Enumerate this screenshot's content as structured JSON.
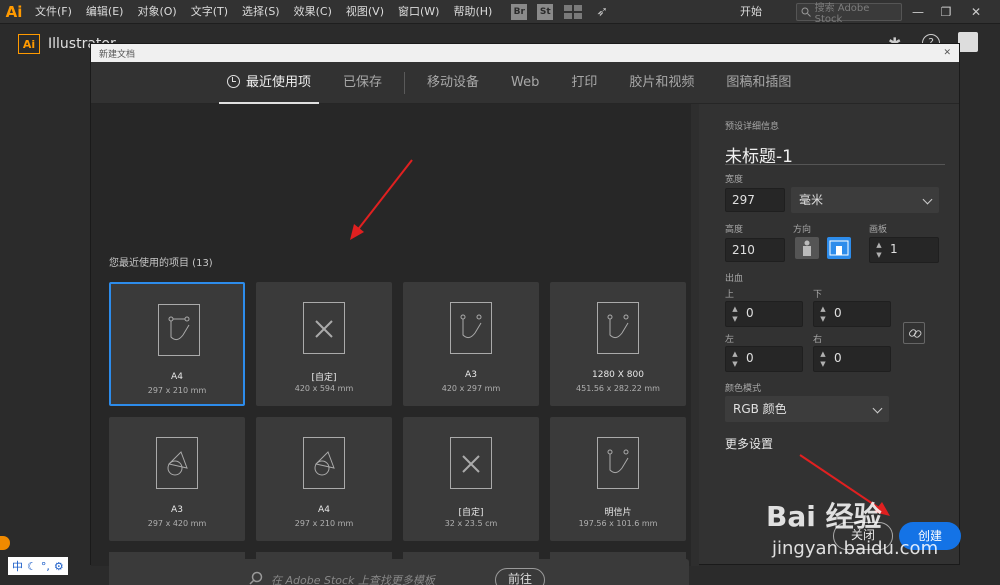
{
  "menubar": {
    "logo": "Ai",
    "items": [
      "文件(F)",
      "编辑(E)",
      "对象(O)",
      "文字(T)",
      "选择(S)",
      "效果(C)",
      "视图(V)",
      "窗口(W)",
      "帮助(H)"
    ],
    "bridge": "Br",
    "stock": "St",
    "workspace": "开始",
    "search_placeholder": "搜索 Adobe Stock"
  },
  "appbar": {
    "logo": "Ai",
    "title": "Illustrator"
  },
  "dialog": {
    "title": "新建文档",
    "tabs": [
      "最近使用项",
      "已保存",
      "移动设备",
      "Web",
      "打印",
      "胶片和视频",
      "图稿和插图"
    ],
    "recent_label": "您最近使用的项目 (13)",
    "presets": [
      {
        "name": "A4",
        "size": "297 x 210 mm",
        "icon": "artboard-icon",
        "selected": true
      },
      {
        "name": "[自定]",
        "size": "420 x 594 mm",
        "icon": "custom-doc-icon"
      },
      {
        "name": "A3",
        "size": "420 x 297 mm",
        "icon": "artboard-icon"
      },
      {
        "name": "1280 X 800",
        "size": "451.56 x 282.22 mm",
        "icon": "artboard-icon"
      },
      {
        "name": "A3",
        "size": "297 x 420 mm",
        "icon": "shapes-icon"
      },
      {
        "name": "A4",
        "size": "297 x 210 mm",
        "icon": "shapes-icon"
      },
      {
        "name": "[自定]",
        "size": "32 x 23.5 cm",
        "icon": "custom-doc-icon"
      },
      {
        "name": "明信片",
        "size": "197.56 x 101.6 mm",
        "icon": "artboard-icon"
      }
    ],
    "stock_search_placeholder": "在 Adobe Stock 上查找更多模板",
    "go_button": "前往",
    "details": {
      "header": "预设详细信息",
      "doc_name": "未标题-1",
      "width_label": "宽度",
      "width": "297",
      "unit": "毫米",
      "height_label": "高度",
      "height": "210",
      "orientation_label": "方向",
      "artboards_label": "画板",
      "artboards": "1",
      "bleed_label": "出血",
      "top_label": "上",
      "bottom_label": "下",
      "left_label": "左",
      "right_label": "右",
      "bleed_top": "0",
      "bleed_bottom": "0",
      "bleed_left": "0",
      "bleed_right": "0",
      "color_mode_label": "颜色模式",
      "color_mode": "RGB 颜色",
      "more_settings": "更多设置",
      "close_button": "关闭",
      "create_button": "创建"
    }
  },
  "watermark": {
    "main": "Bai 经验",
    "sub": "jingyan.baidu.com"
  },
  "ime": {
    "label": "中"
  },
  "colors": {
    "accent": "#1473e6",
    "selection": "#2d8ceb",
    "annotation_arrow": "#e02020"
  }
}
